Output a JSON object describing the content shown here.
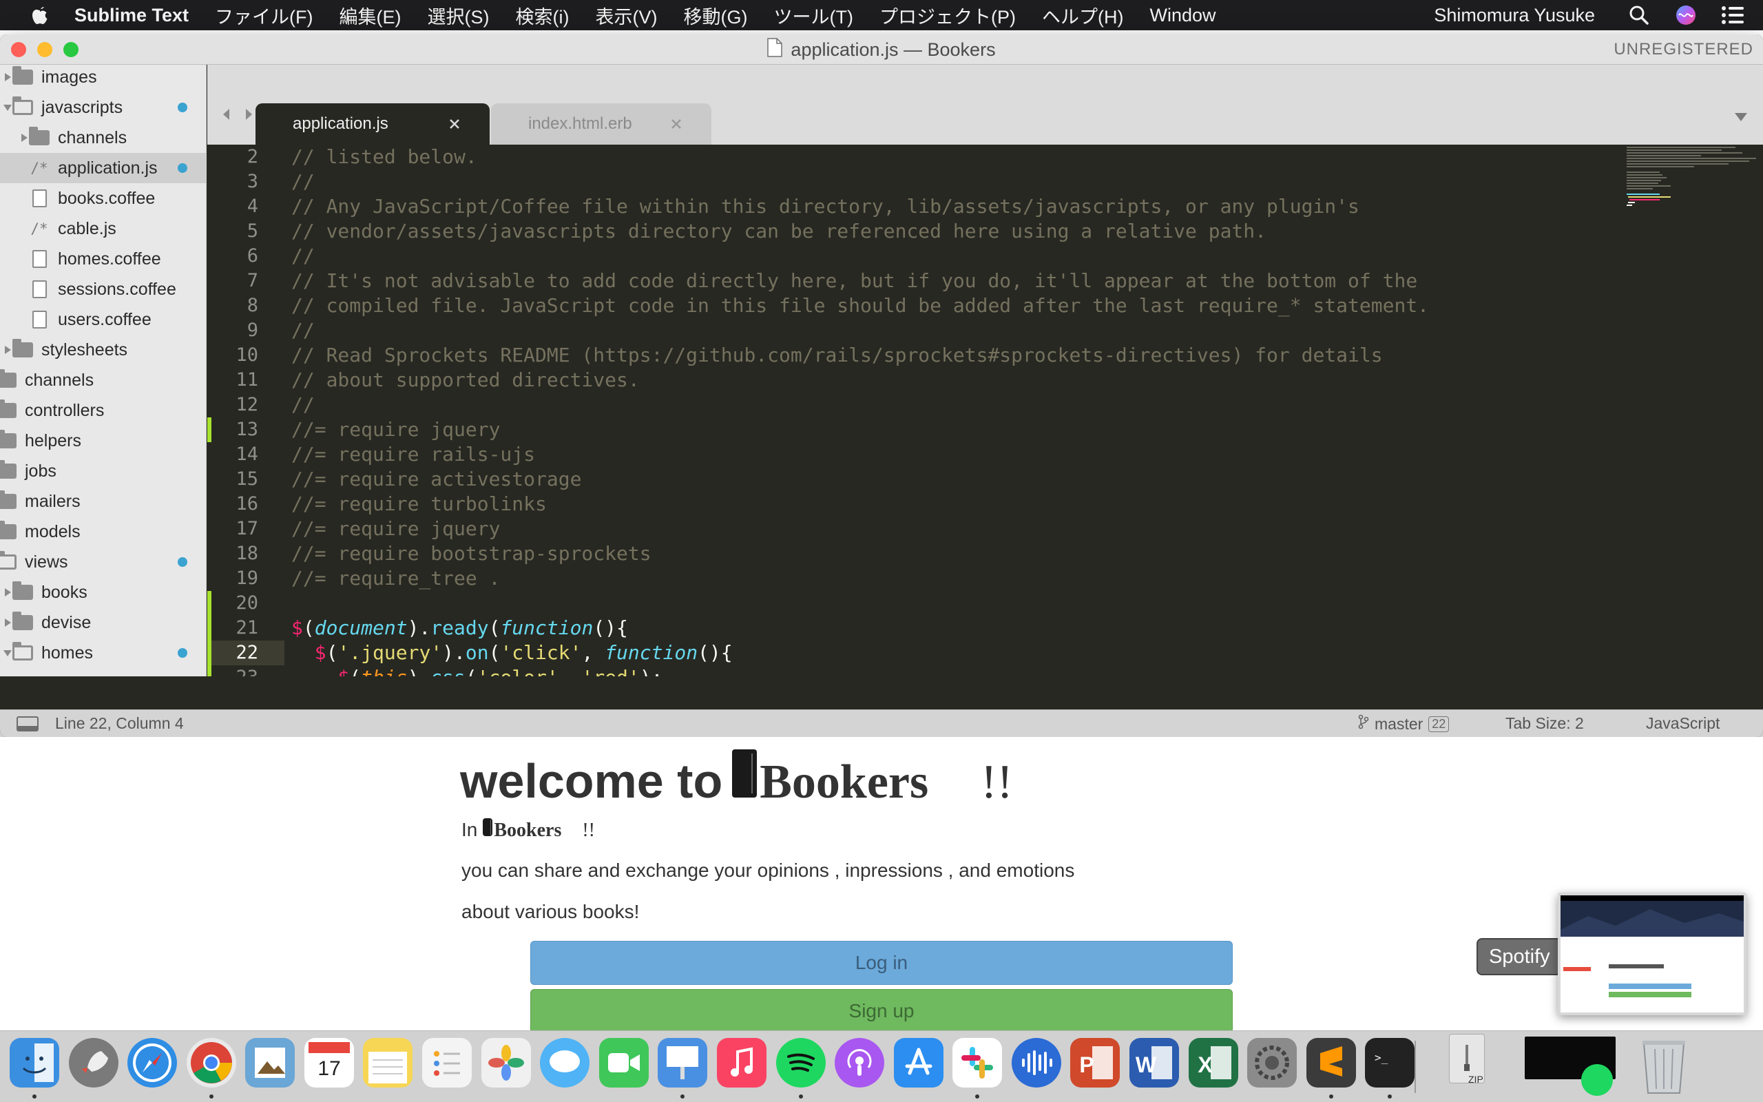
{
  "menubar": {
    "app_name": "Sublime Text",
    "items": [
      "ファイル(F)",
      "編集(E)",
      "選択(S)",
      "検索(i)",
      "表示(V)",
      "移動(G)",
      "ツール(T)",
      "プロジェクト(P)",
      "ヘルプ(H)",
      "Window"
    ],
    "user": "Shimomura Yusuke"
  },
  "window": {
    "title": "application.js — Bookers",
    "unregistered": "UNREGISTERED",
    "traffic_colors": [
      "#fe5f57",
      "#febc2e",
      "#28c840"
    ]
  },
  "sidebar": {
    "items": [
      {
        "label": "images",
        "kind": "folder"
      },
      {
        "label": "javascripts",
        "kind": "folder-open",
        "modified": true
      },
      {
        "label": "channels",
        "kind": "folder"
      },
      {
        "label": "application.js",
        "kind": "file-js",
        "icon_text": "/*",
        "modified": true,
        "selected": true
      },
      {
        "label": "books.coffee",
        "kind": "file"
      },
      {
        "label": "cable.js",
        "kind": "file-js",
        "icon_text": "/*"
      },
      {
        "label": "homes.coffee",
        "kind": "file"
      },
      {
        "label": "sessions.coffee",
        "kind": "file"
      },
      {
        "label": "users.coffee",
        "kind": "file"
      },
      {
        "label": "stylesheets",
        "kind": "folder"
      },
      {
        "label": "channels",
        "kind": "folder"
      },
      {
        "label": "controllers",
        "kind": "folder"
      },
      {
        "label": "helpers",
        "kind": "folder"
      },
      {
        "label": "jobs",
        "kind": "folder"
      },
      {
        "label": "mailers",
        "kind": "folder"
      },
      {
        "label": "models",
        "kind": "folder"
      },
      {
        "label": "views",
        "kind": "folder-open",
        "modified": true
      },
      {
        "label": "books",
        "kind": "folder"
      },
      {
        "label": "devise",
        "kind": "folder"
      },
      {
        "label": "homes",
        "kind": "folder-open",
        "modified": true
      },
      {
        "label": "index.html.erb",
        "kind": "file-erb",
        "icon_text": "<>",
        "modified": true
      }
    ]
  },
  "tabs": [
    {
      "label": "application.js",
      "active": true
    },
    {
      "label": "index.html.erb",
      "active": false
    }
  ],
  "editor": {
    "current_line": 22,
    "lines": [
      {
        "n": "2",
        "tokens": [
          {
            "t": "// listed below.",
            "c": "cm"
          }
        ]
      },
      {
        "n": "3",
        "tokens": [
          {
            "t": "//",
            "c": "cm"
          }
        ]
      },
      {
        "n": "4",
        "tokens": [
          {
            "t": "// Any JavaScript/Coffee file within this directory, lib/assets/javascripts, or any plugin's",
            "c": "cm"
          }
        ]
      },
      {
        "n": "5",
        "tokens": [
          {
            "t": "// vendor/assets/javascripts directory can be referenced here using a relative path.",
            "c": "cm"
          }
        ]
      },
      {
        "n": "6",
        "tokens": [
          {
            "t": "//",
            "c": "cm"
          }
        ]
      },
      {
        "n": "7",
        "tokens": [
          {
            "t": "// It's not advisable to add code directly here, but if you do, it'll appear at the bottom of the",
            "c": "cm"
          }
        ]
      },
      {
        "n": "8",
        "tokens": [
          {
            "t": "// compiled file. JavaScript code in this file should be added after the last require_* statement.",
            "c": "cm"
          }
        ]
      },
      {
        "n": "9",
        "tokens": [
          {
            "t": "//",
            "c": "cm"
          }
        ]
      },
      {
        "n": "10",
        "tokens": [
          {
            "t": "// Read Sprockets README (https://github.com/rails/sprockets#sprockets-directives) for details",
            "c": "cm"
          }
        ]
      },
      {
        "n": "11",
        "tokens": [
          {
            "t": "// about supported directives.",
            "c": "cm"
          }
        ]
      },
      {
        "n": "12",
        "tokens": [
          {
            "t": "//",
            "c": "cm"
          }
        ]
      },
      {
        "n": "13",
        "tokens": [
          {
            "t": "//= require jquery",
            "c": "cm"
          }
        ]
      },
      {
        "n": "14",
        "tokens": [
          {
            "t": "//= require rails-ujs",
            "c": "cm"
          }
        ]
      },
      {
        "n": "15",
        "tokens": [
          {
            "t": "//= require activestorage",
            "c": "cm"
          }
        ]
      },
      {
        "n": "16",
        "tokens": [
          {
            "t": "//= require turbolinks",
            "c": "cm"
          }
        ]
      },
      {
        "n": "17",
        "tokens": [
          {
            "t": "//= require jquery",
            "c": "cm"
          }
        ]
      },
      {
        "n": "18",
        "tokens": [
          {
            "t": "//= require bootstrap-sprockets",
            "c": "cm"
          }
        ]
      },
      {
        "n": "19",
        "tokens": [
          {
            "t": "//= require_tree .",
            "c": "cm"
          }
        ]
      },
      {
        "n": "20",
        "tokens": []
      },
      {
        "n": "21",
        "tokens": [
          {
            "t": "$",
            "c": "dl"
          },
          {
            "t": "(",
            "c": "pl"
          },
          {
            "t": "document",
            "c": "kw"
          },
          {
            "t": ").",
            "c": "pl"
          },
          {
            "t": "ready",
            "c": "fn"
          },
          {
            "t": "(",
            "c": "pl"
          },
          {
            "t": "function",
            "c": "kw"
          },
          {
            "t": "(){",
            "c": "pl"
          }
        ]
      },
      {
        "n": "22",
        "tokens": [
          {
            "t": "  ",
            "c": "pl"
          },
          {
            "t": "$",
            "c": "dl"
          },
          {
            "t": "(",
            "c": "pl"
          },
          {
            "t": "'.jquery'",
            "c": "str"
          },
          {
            "t": ").",
            "c": "pl"
          },
          {
            "t": "on",
            "c": "fn"
          },
          {
            "t": "(",
            "c": "pl"
          },
          {
            "t": "'click'",
            "c": "str"
          },
          {
            "t": ", ",
            "c": "pl"
          },
          {
            "t": "function",
            "c": "kw"
          },
          {
            "t": "(){",
            "c": "pl"
          }
        ]
      },
      {
        "n": "23",
        "tokens": [
          {
            "t": "    ",
            "c": "pl"
          },
          {
            "t": "$",
            "c": "dl"
          },
          {
            "t": "(",
            "c": "pl"
          },
          {
            "t": "this",
            "c": "th"
          },
          {
            "t": ").",
            "c": "pl"
          },
          {
            "t": "css",
            "c": "fn"
          },
          {
            "t": "(",
            "c": "pl"
          },
          {
            "t": "'color'",
            "c": "str"
          },
          {
            "t": ", ",
            "c": "pl"
          },
          {
            "t": "'red'",
            "c": "str"
          },
          {
            "t": ");",
            "c": "pl"
          }
        ]
      },
      {
        "n": "24",
        "tokens": [
          {
            "t": "  });",
            "c": "pl"
          }
        ]
      },
      {
        "n": "25",
        "tokens": [
          {
            "t": "});",
            "c": "pl"
          }
        ]
      }
    ]
  },
  "statusbar": {
    "position": "Line 22, Column 4",
    "branch": "master",
    "branch_count": "22",
    "tab_size": "Tab Size: 2",
    "syntax": "JavaScript"
  },
  "page": {
    "welcome_prefix": "welcome to",
    "brand": "Bookers",
    "bang": "!!",
    "in_prefix": "In",
    "line1": "you can share and exchange your opinions , inpressions , and emotions",
    "line2": "about various books!",
    "login_label": "Log in",
    "signup_label": "Sign up"
  },
  "tooltip": {
    "label": "Spotify"
  },
  "dock": {
    "zip_label": "ZIP",
    "apps": [
      {
        "name": "finder-icon",
        "color": "#3b8fe0",
        "dot": true
      },
      {
        "name": "launchpad-icon",
        "color": "#7a7a7a",
        "dot": false
      },
      {
        "name": "safari-icon",
        "color": "#2f8de4",
        "dot": false
      },
      {
        "name": "chrome-icon",
        "color": "#e9e9e9",
        "dot": true
      },
      {
        "name": "preview-icon",
        "color": "#6aa6d6",
        "dot": false
      },
      {
        "name": "calendar-icon",
        "color": "#ffffff",
        "dot": false
      },
      {
        "name": "notes-icon",
        "color": "#f7d655",
        "dot": false
      },
      {
        "name": "reminders-icon",
        "color": "#f4f4f4",
        "dot": false
      },
      {
        "name": "photos-icon",
        "color": "#f0f0f0",
        "dot": false
      },
      {
        "name": "messages-icon",
        "color": "#4fb3f6",
        "dot": false
      },
      {
        "name": "facetime-icon",
        "color": "#3fc759",
        "dot": false
      },
      {
        "name": "keynote-icon",
        "color": "#4a90e2",
        "dot": true
      },
      {
        "name": "music-icon",
        "color": "#fa4363",
        "dot": false
      },
      {
        "name": "spotify-icon",
        "color": "#1ed760",
        "dot": true
      },
      {
        "name": "podcasts-icon",
        "color": "#a857f0",
        "dot": false
      },
      {
        "name": "app-store-icon",
        "color": "#2b8ef0",
        "dot": false
      },
      {
        "name": "slack-icon",
        "color": "#ffffff",
        "dot": true
      },
      {
        "name": "audio-app-icon",
        "color": "#2a6bd6",
        "dot": false
      },
      {
        "name": "powerpoint-icon",
        "color": "#d0492a",
        "dot": false
      },
      {
        "name": "word-icon",
        "color": "#2b5cb0",
        "dot": false
      },
      {
        "name": "excel-icon",
        "color": "#207245",
        "dot": false
      },
      {
        "name": "system-preferences-icon",
        "color": "#8b8b8b",
        "dot": false
      },
      {
        "name": "sublime-text-icon",
        "color": "#3b3b3b",
        "dot": true
      },
      {
        "name": "terminal-icon",
        "color": "#222222",
        "dot": true
      }
    ]
  }
}
